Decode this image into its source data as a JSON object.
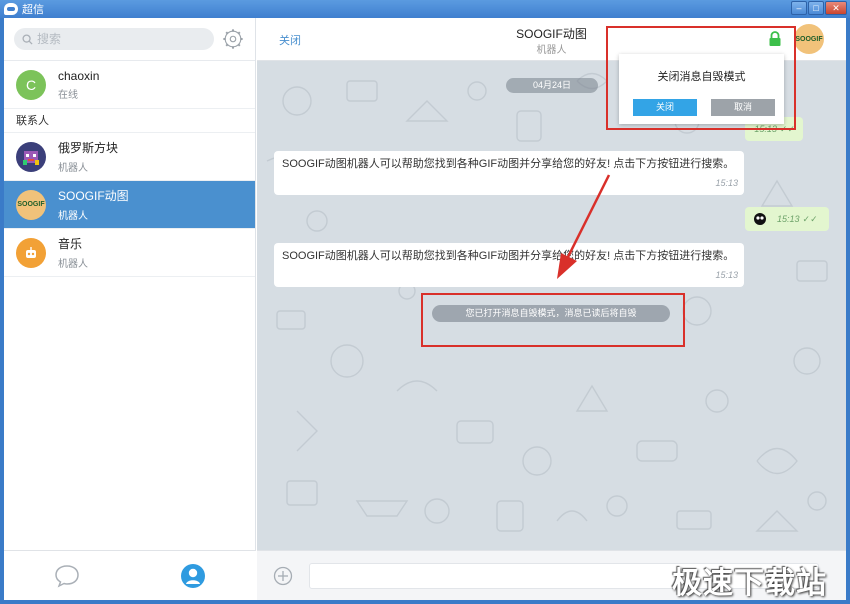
{
  "window": {
    "title": "超信"
  },
  "sidebar": {
    "search_placeholder": "搜索",
    "me": {
      "initial": "C",
      "name": "chaoxin",
      "status": "在线",
      "color": "#7cc35a"
    },
    "section_label": "联系人",
    "contacts": [
      {
        "name": "俄罗斯方块",
        "sub": "机器人",
        "color": "#3b3f7a"
      },
      {
        "name": "SOOGIF动图",
        "sub": "机器人",
        "color": "#f1c27a",
        "avatar_text": "SOOGIF"
      },
      {
        "name": "音乐",
        "sub": "机器人",
        "color": "#f2a136"
      }
    ]
  },
  "chat": {
    "close_label": "关闭",
    "title": "SOOGIF动图",
    "subtitle": "机器人",
    "avatar_text": "SOOGIF",
    "date": "04月24日",
    "messages": [
      {
        "text": "SOOGIF动图机器人可以帮助您找到各种GIF动图并分享给您的好友! 点击下方按钮进行搜索。",
        "time": "15:13"
      },
      {
        "text": "SOOGIF动图机器人可以帮助您找到各种GIF动图并分享给您的好友! 点击下方按钮进行搜索。",
        "time": "15:13"
      }
    ],
    "out_times": [
      "15:13",
      "15:13"
    ],
    "system_notice": "您已打开消息自毁模式，消息已读后将自毁",
    "popup": {
      "title": "关闭消息自毁模式",
      "confirm": "关闭",
      "cancel": "取消"
    }
  },
  "watermark": "极速下载站"
}
